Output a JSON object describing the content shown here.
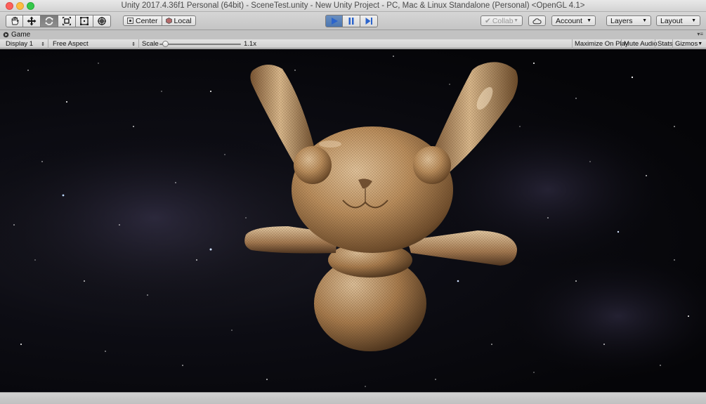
{
  "window": {
    "title": "Unity 2017.4.36f1 Personal (64bit) - SceneTest.unity - New Unity Project - PC, Mac & Linux Standalone (Personal) <OpenGL 4.1>"
  },
  "toolbar": {
    "tools": [
      {
        "icon": "hand-icon"
      },
      {
        "icon": "move-icon"
      },
      {
        "icon": "rotate-icon",
        "active": true
      },
      {
        "icon": "scale-icon"
      },
      {
        "icon": "rect-tool-icon"
      },
      {
        "icon": "transform-icon"
      }
    ],
    "pivot_label": "Center",
    "space_label": "Local",
    "collab_label": "Collab",
    "account_label": "Account",
    "layers_label": "Layers",
    "layout_label": "Layout",
    "colors": {
      "play_active": "#4c76b0",
      "play_icon": "#1f56c4"
    }
  },
  "game_panel": {
    "tab_label": "Game",
    "display_label": "Display 1",
    "aspect_label": "Free Aspect",
    "scale_label": "Scale",
    "scale_value": "1.1x",
    "scale_fraction": 0.05,
    "maximize_label": "Maximize On Play",
    "mute_label": "Mute Audio",
    "stats_label": "Stats",
    "gizmos_label": "Gizmos"
  }
}
